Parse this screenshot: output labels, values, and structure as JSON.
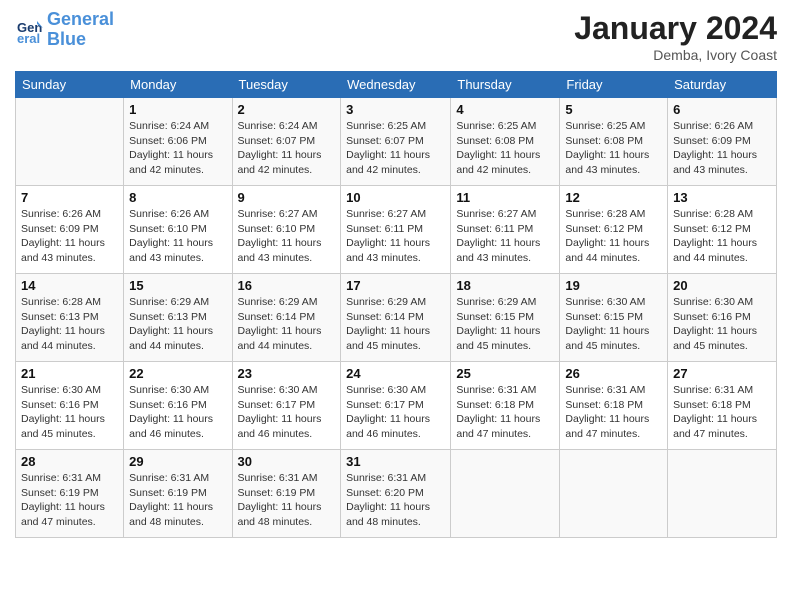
{
  "logo": {
    "line1": "General",
    "line2": "Blue"
  },
  "title": "January 2024",
  "subtitle": "Demba, Ivory Coast",
  "days_of_week": [
    "Sunday",
    "Monday",
    "Tuesday",
    "Wednesday",
    "Thursday",
    "Friday",
    "Saturday"
  ],
  "weeks": [
    [
      {
        "day": "",
        "info": ""
      },
      {
        "day": "1",
        "info": "Sunrise: 6:24 AM\nSunset: 6:06 PM\nDaylight: 11 hours and 42 minutes."
      },
      {
        "day": "2",
        "info": "Sunrise: 6:24 AM\nSunset: 6:07 PM\nDaylight: 11 hours and 42 minutes."
      },
      {
        "day": "3",
        "info": "Sunrise: 6:25 AM\nSunset: 6:07 PM\nDaylight: 11 hours and 42 minutes."
      },
      {
        "day": "4",
        "info": "Sunrise: 6:25 AM\nSunset: 6:08 PM\nDaylight: 11 hours and 42 minutes."
      },
      {
        "day": "5",
        "info": "Sunrise: 6:25 AM\nSunset: 6:08 PM\nDaylight: 11 hours and 43 minutes."
      },
      {
        "day": "6",
        "info": "Sunrise: 6:26 AM\nSunset: 6:09 PM\nDaylight: 11 hours and 43 minutes."
      }
    ],
    [
      {
        "day": "7",
        "info": "Sunrise: 6:26 AM\nSunset: 6:09 PM\nDaylight: 11 hours and 43 minutes."
      },
      {
        "day": "8",
        "info": "Sunrise: 6:26 AM\nSunset: 6:10 PM\nDaylight: 11 hours and 43 minutes."
      },
      {
        "day": "9",
        "info": "Sunrise: 6:27 AM\nSunset: 6:10 PM\nDaylight: 11 hours and 43 minutes."
      },
      {
        "day": "10",
        "info": "Sunrise: 6:27 AM\nSunset: 6:11 PM\nDaylight: 11 hours and 43 minutes."
      },
      {
        "day": "11",
        "info": "Sunrise: 6:27 AM\nSunset: 6:11 PM\nDaylight: 11 hours and 43 minutes."
      },
      {
        "day": "12",
        "info": "Sunrise: 6:28 AM\nSunset: 6:12 PM\nDaylight: 11 hours and 44 minutes."
      },
      {
        "day": "13",
        "info": "Sunrise: 6:28 AM\nSunset: 6:12 PM\nDaylight: 11 hours and 44 minutes."
      }
    ],
    [
      {
        "day": "14",
        "info": "Sunrise: 6:28 AM\nSunset: 6:13 PM\nDaylight: 11 hours and 44 minutes."
      },
      {
        "day": "15",
        "info": "Sunrise: 6:29 AM\nSunset: 6:13 PM\nDaylight: 11 hours and 44 minutes."
      },
      {
        "day": "16",
        "info": "Sunrise: 6:29 AM\nSunset: 6:14 PM\nDaylight: 11 hours and 44 minutes."
      },
      {
        "day": "17",
        "info": "Sunrise: 6:29 AM\nSunset: 6:14 PM\nDaylight: 11 hours and 45 minutes."
      },
      {
        "day": "18",
        "info": "Sunrise: 6:29 AM\nSunset: 6:15 PM\nDaylight: 11 hours and 45 minutes."
      },
      {
        "day": "19",
        "info": "Sunrise: 6:30 AM\nSunset: 6:15 PM\nDaylight: 11 hours and 45 minutes."
      },
      {
        "day": "20",
        "info": "Sunrise: 6:30 AM\nSunset: 6:16 PM\nDaylight: 11 hours and 45 minutes."
      }
    ],
    [
      {
        "day": "21",
        "info": "Sunrise: 6:30 AM\nSunset: 6:16 PM\nDaylight: 11 hours and 45 minutes."
      },
      {
        "day": "22",
        "info": "Sunrise: 6:30 AM\nSunset: 6:16 PM\nDaylight: 11 hours and 46 minutes."
      },
      {
        "day": "23",
        "info": "Sunrise: 6:30 AM\nSunset: 6:17 PM\nDaylight: 11 hours and 46 minutes."
      },
      {
        "day": "24",
        "info": "Sunrise: 6:30 AM\nSunset: 6:17 PM\nDaylight: 11 hours and 46 minutes."
      },
      {
        "day": "25",
        "info": "Sunrise: 6:31 AM\nSunset: 6:18 PM\nDaylight: 11 hours and 47 minutes."
      },
      {
        "day": "26",
        "info": "Sunrise: 6:31 AM\nSunset: 6:18 PM\nDaylight: 11 hours and 47 minutes."
      },
      {
        "day": "27",
        "info": "Sunrise: 6:31 AM\nSunset: 6:18 PM\nDaylight: 11 hours and 47 minutes."
      }
    ],
    [
      {
        "day": "28",
        "info": "Sunrise: 6:31 AM\nSunset: 6:19 PM\nDaylight: 11 hours and 47 minutes."
      },
      {
        "day": "29",
        "info": "Sunrise: 6:31 AM\nSunset: 6:19 PM\nDaylight: 11 hours and 48 minutes."
      },
      {
        "day": "30",
        "info": "Sunrise: 6:31 AM\nSunset: 6:19 PM\nDaylight: 11 hours and 48 minutes."
      },
      {
        "day": "31",
        "info": "Sunrise: 6:31 AM\nSunset: 6:20 PM\nDaylight: 11 hours and 48 minutes."
      },
      {
        "day": "",
        "info": ""
      },
      {
        "day": "",
        "info": ""
      },
      {
        "day": "",
        "info": ""
      }
    ]
  ]
}
